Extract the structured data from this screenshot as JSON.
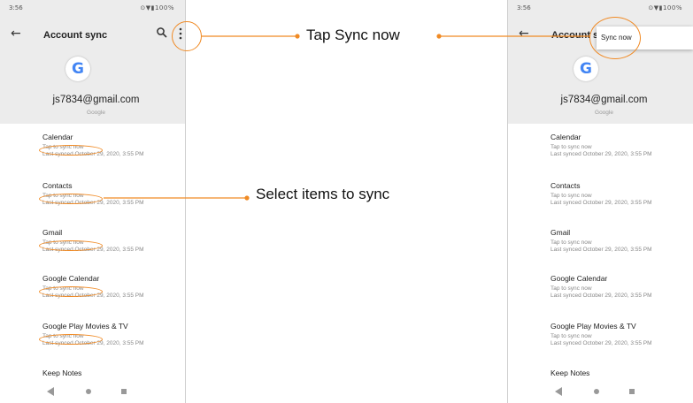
{
  "colors": {
    "accent_orange": "#f08a24",
    "google_blue": "#4285f4",
    "header_gray": "#ececec"
  },
  "phones": {
    "left": {
      "status": {
        "time": "3:56",
        "icons": "⊙▼▮100%"
      },
      "app_bar": {
        "title": "Account sync",
        "back_icon": "arrow-back-icon",
        "search_icon": "search-icon",
        "more_icon": "more-vertical-icon"
      },
      "account": {
        "logo_letter": "G",
        "email": "js7834@gmail.com",
        "provider": "Google"
      },
      "items": [
        {
          "name": "Calendar",
          "hint": "Tap to sync now",
          "last": "Last synced October 29, 2020, 3:55 PM"
        },
        {
          "name": "Contacts",
          "hint": "Tap to sync now",
          "last": "Last synced October 29, 2020, 3:55 PM"
        },
        {
          "name": "Gmail",
          "hint": "Tap to sync now",
          "last": "Last synced October 29, 2020, 3:55 PM"
        },
        {
          "name": "Google Calendar",
          "hint": "Tap to sync now",
          "last": "Last synced October 29, 2020, 3:55 PM"
        },
        {
          "name": "Google Play Movies & TV",
          "hint": "Tap to sync now",
          "last": "Last synced October 29, 2020, 3:55 PM"
        },
        {
          "name": "Keep Notes",
          "hint": "",
          "last": ""
        }
      ]
    },
    "right": {
      "status": {
        "time": "3:56",
        "icons": "⊙▼▮100%"
      },
      "app_bar": {
        "title": "Account s",
        "back_icon": "arrow-back-icon"
      },
      "menu": {
        "sync_now_label": "Sync now"
      },
      "account": {
        "logo_letter": "G",
        "email": "js7834@gmail.com",
        "provider": "Google"
      },
      "items": [
        {
          "name": "Calendar",
          "hint": "Tap to sync now",
          "last": "Last synced October 29, 2020, 3:55 PM"
        },
        {
          "name": "Contacts",
          "hint": "Tap to sync now",
          "last": "Last synced October 29, 2020, 3:55 PM"
        },
        {
          "name": "Gmail",
          "hint": "Tap to sync now",
          "last": "Last synced October 29, 2020, 3:55 PM"
        },
        {
          "name": "Google Calendar",
          "hint": "Tap to sync now",
          "last": "Last synced October 29, 2020, 3:55 PM"
        },
        {
          "name": "Google Play Movies & TV",
          "hint": "Tap to sync now",
          "last": "Last synced October 29, 2020, 3:55 PM"
        },
        {
          "name": "Keep Notes",
          "hint": "",
          "last": ""
        }
      ]
    }
  },
  "callouts": {
    "tap_sync_now": "Tap Sync now",
    "select_items": "Select items to sync"
  }
}
